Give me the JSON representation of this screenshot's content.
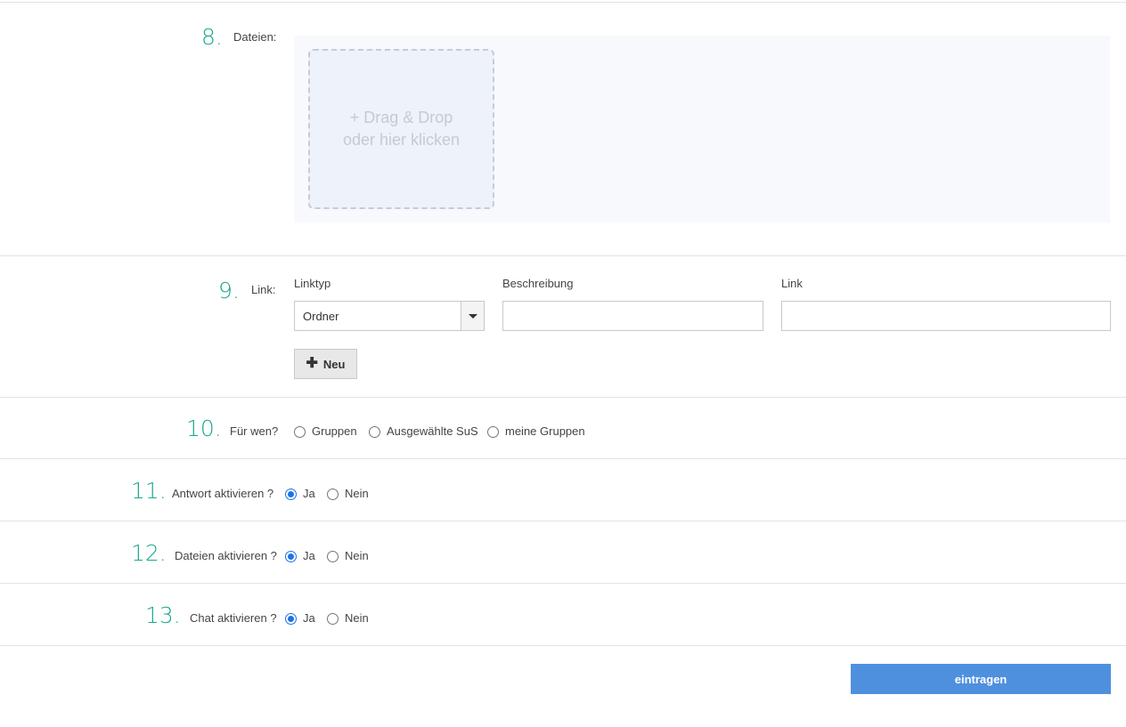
{
  "files": {
    "number": "8.",
    "label": "Dateien:",
    "dropzone_line1": "+ Drag & Drop",
    "dropzone_line2": "oder hier klicken"
  },
  "link": {
    "number": "9.",
    "label": "Link:",
    "col_type": "Linktyp",
    "col_description": "Beschreibung",
    "col_link": "Link",
    "type_value": "Ordner",
    "description_value": "",
    "link_value": "",
    "new_button": "Neu"
  },
  "audience": {
    "number": "10.",
    "label": "Für wen?",
    "options": [
      "Gruppen",
      "Ausgewählte SuS",
      "meine Gruppen"
    ]
  },
  "answer": {
    "number": "11.",
    "label": "Antwort aktivieren ?",
    "yes": "Ja",
    "no": "Nein",
    "selected": "Ja"
  },
  "files_enable": {
    "number": "12.",
    "label": "Dateien aktivieren ?",
    "yes": "Ja",
    "no": "Nein",
    "selected": "Ja"
  },
  "chat": {
    "number": "13.",
    "label": "Chat aktivieren ?",
    "yes": "Ja",
    "no": "Nein",
    "selected": "Ja"
  },
  "submit_label": "eintragen",
  "colors": {
    "accent_number": "#1aa88e",
    "submit_bg": "#4f90de",
    "radio_checked": "#1a73e8"
  }
}
